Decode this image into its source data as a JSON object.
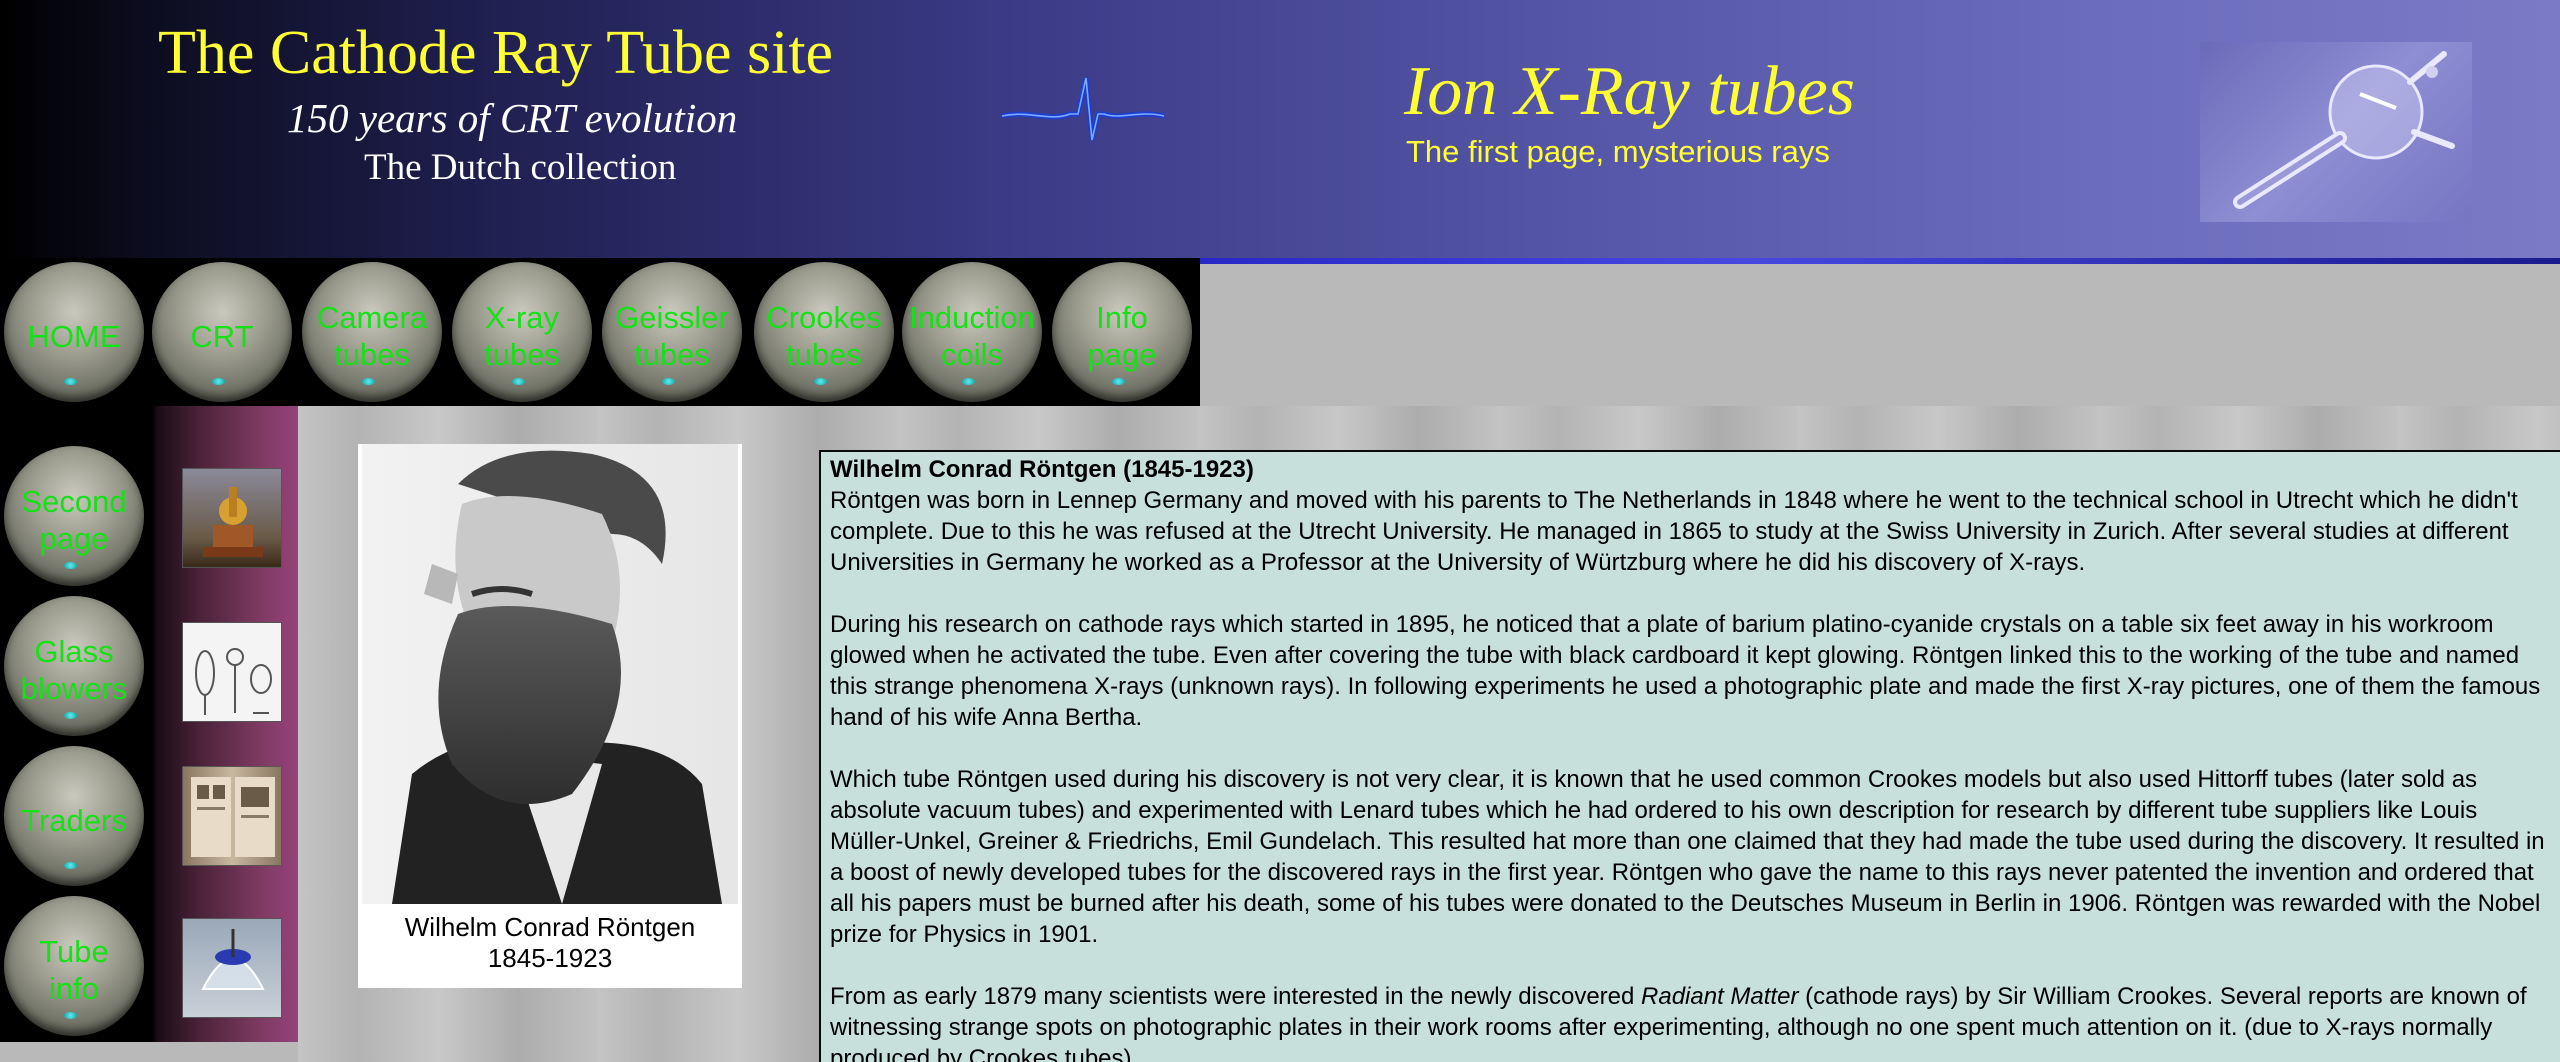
{
  "header": {
    "site_title": "The Cathode Ray Tube site",
    "site_subtitle": "150 years of  CRT evolution",
    "site_collection": "The Dutch collection",
    "page_heading": "Ion X-Ray tubes",
    "page_subheading": "The first page, mysterious rays"
  },
  "colors": {
    "title_yellow": "#ffff33",
    "nav_label_green": "#16e016",
    "article_background": "#c7e0dc",
    "sidebar_purple": "#95437a"
  },
  "top_nav": [
    {
      "label": "HOME"
    },
    {
      "label": "CRT"
    },
    {
      "label": "Camera\ntubes"
    },
    {
      "label": "X-ray\ntubes"
    },
    {
      "label": "Geissler\ntubes"
    },
    {
      "label": "Crookes\ntubes"
    },
    {
      "label": "Induction\ncoils"
    },
    {
      "label": "Info\npage"
    }
  ],
  "side_nav": [
    {
      "label": "Second\npage",
      "thumb": "induction-coil-apparatus-thumbnail"
    },
    {
      "label": "Glass\nblowers",
      "thumb": "glass-tubes-drawing-thumbnail"
    },
    {
      "label": "Traders",
      "thumb": "catalog-book-thumbnail"
    },
    {
      "label": "Tube\ninfo",
      "thumb": "blue-tube-thumbnail"
    }
  ],
  "portrait": {
    "caption_name": "Wilhelm Conrad Röntgen",
    "caption_years": "1845-1923"
  },
  "article": {
    "heading": "Wilhelm Conrad Röntgen (1845-1923)",
    "p1": "Röntgen was born in Lennep Germany and moved with his parents to The Netherlands in 1848 where he went to the technical school in Utrecht which he didn't complete. Due to this he was refused at the Utrecht University. He managed in 1865 to study at the Swiss University in Zurich. After several studies at different Universities in Germany he worked as a Professor at the University of Würtzburg where he did his discovery of X-rays.",
    "p2": "During his research on cathode rays which started in 1895, he noticed that a plate of barium platino-cyanide crystals on a table six feet away in his workroom glowed when he activated the tube. Even after covering the tube with black cardboard it kept glowing. Röntgen linked this to the working of the tube and named this strange phenomena X-rays (unknown rays). In following experiments he used a photographic plate and made the first X-ray pictures, one of them the famous hand of his wife Anna Bertha.",
    "p3": "Which tube Röntgen used during his discovery is not very clear, it is known that he used common Crookes models but also used Hittorff tubes (later sold as absolute vacuum tubes) and experimented with Lenard tubes which he had ordered to his own description for research by different tube suppliers like Louis Müller-Unkel, Greiner & Friedrichs, Emil Gundelach. This resulted hat more than one claimed that they had made the tube used during the discovery. It resulted in a boost of newly developed tubes for the discovered rays in the first year. Röntgen who gave the name to this rays never patented the invention and ordered that all his papers must be burned after his death, some of his tubes were donated to the Deutsches Museum in Berlin in 1906.  Röntgen was rewarded with the Nobel prize for Physics in 1901.",
    "p4_before": "From as early 1879 many scientists were interested in the newly discovered ",
    "p4_italic": "Radiant Matter",
    "p4_after": " (cathode rays) by Sir William Crookes. Several reports are known of witnessing strange spots on photographic plates in their work rooms after experimenting, although no one spent much attention on it. (due to X-rays normally produced by Crookes tubes)"
  }
}
